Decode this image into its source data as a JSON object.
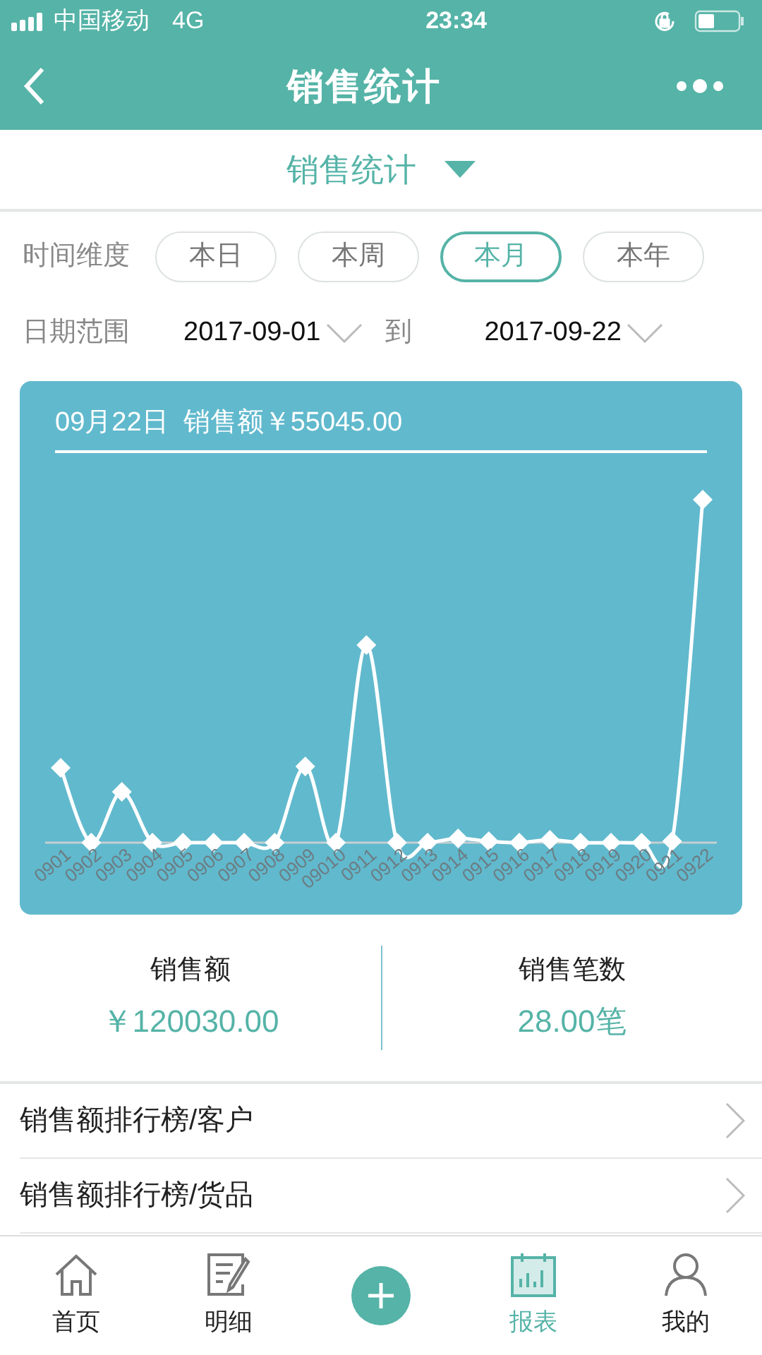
{
  "status_bar": {
    "carrier": "中国移动",
    "network": "4G",
    "time": "23:34"
  },
  "nav_bar": {
    "title": "销售统计"
  },
  "selector": {
    "label": "销售统计"
  },
  "time_dimension": {
    "label": "时间维度",
    "options": [
      {
        "label": "本日",
        "selected": false
      },
      {
        "label": "本周",
        "selected": false
      },
      {
        "label": "本月",
        "selected": true
      },
      {
        "label": "本年",
        "selected": false
      }
    ]
  },
  "date_range": {
    "label": "日期范围",
    "start": "2017-09-01",
    "separator": "到",
    "end": "2017-09-22"
  },
  "chart": {
    "header": "09月22日  销售额￥55045.00",
    "x_labels": [
      "0901",
      "0902",
      "0903",
      "0904",
      "0905",
      "0906",
      "0907",
      "0908",
      "0909",
      "09010",
      "0911",
      "0912",
      "0913",
      "0914",
      "0915",
      "0916",
      "0917",
      "0918",
      "0919",
      "0920",
      "0921",
      "0922"
    ]
  },
  "summary": [
    {
      "label": "销售额",
      "value": "￥120030.00"
    },
    {
      "label": "销售笔数",
      "value": "28.00笔"
    }
  ],
  "list": [
    {
      "label": "销售额排行榜/客户"
    },
    {
      "label": "销售额排行榜/货品"
    }
  ],
  "tab_bar": [
    {
      "kind": "home",
      "label": "首页",
      "selected": false
    },
    {
      "kind": "detail",
      "label": "明细",
      "selected": false
    },
    {
      "kind": "add",
      "selected": false
    },
    {
      "kind": "report",
      "label": "报表",
      "selected": true
    },
    {
      "kind": "me",
      "label": "我的",
      "selected": false
    }
  ]
}
